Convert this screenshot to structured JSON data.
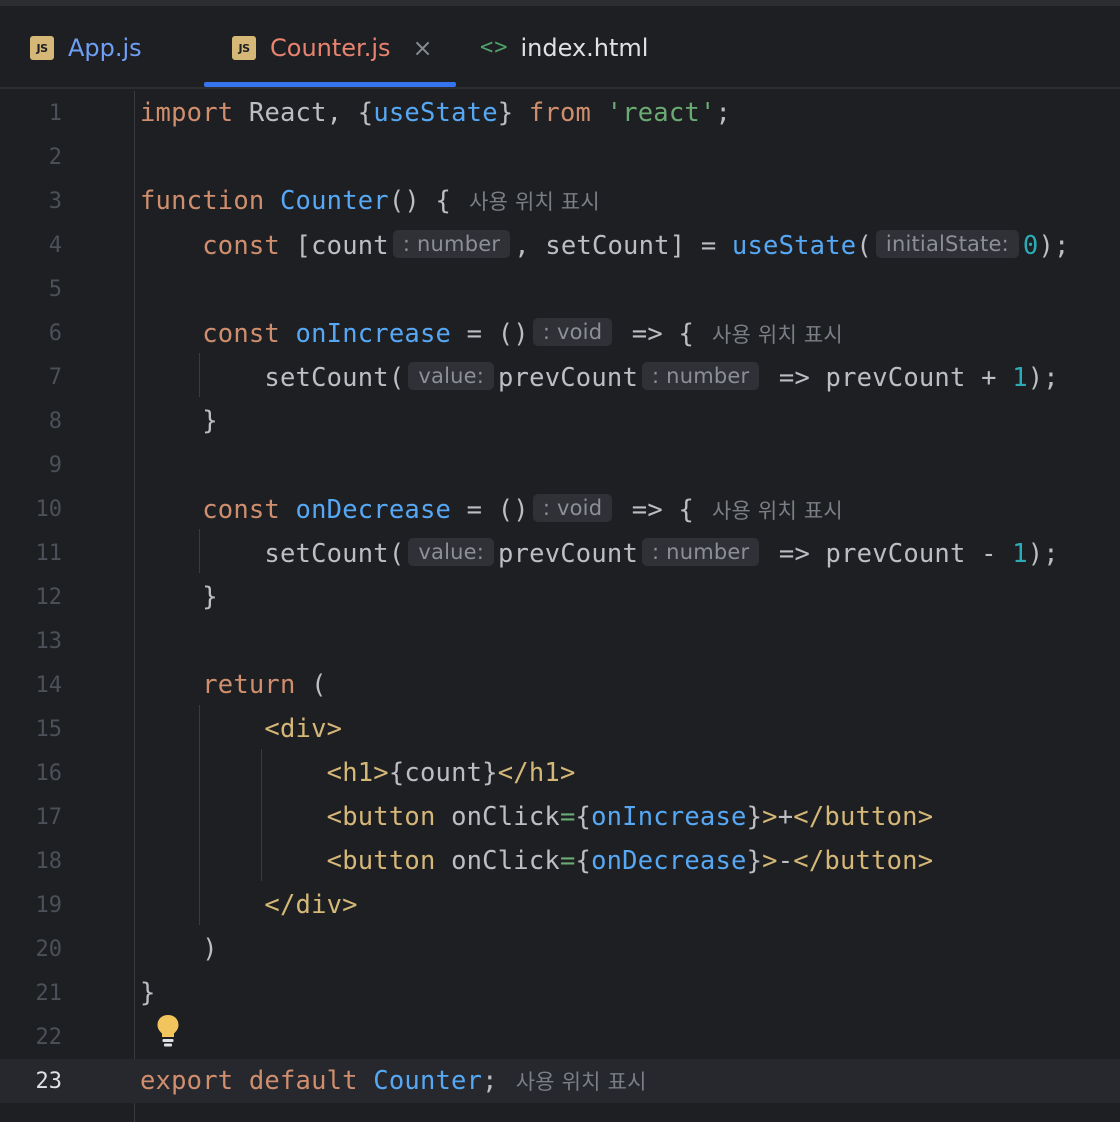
{
  "tabs": [
    {
      "label": "App.js",
      "icon": "js-file-icon"
    },
    {
      "label": "Counter.js",
      "icon": "js-file-icon",
      "active": true
    },
    {
      "label": "index.html",
      "icon": "html-file-icon"
    }
  ],
  "tab_icons": {
    "js": "JS",
    "html": "<>",
    "close": "×"
  },
  "usage_hint": "사용 위치 표시",
  "line_numbers": [
    "1",
    "2",
    "3",
    "4",
    "5",
    "6",
    "7",
    "8",
    "9",
    "10",
    "11",
    "12",
    "13",
    "14",
    "15",
    "16",
    "17",
    "18",
    "19",
    "20",
    "21",
    "22",
    "23"
  ],
  "current_line": "23",
  "code": {
    "l1": {
      "import": "import",
      "react": "React",
      "punc1": ", {",
      "useState": "useState",
      "punc2": "} ",
      "from": "from",
      "str": "'react'",
      "semi": ";"
    },
    "l3": {
      "function": "function",
      "name": "Counter",
      "rest": "() {"
    },
    "l4": {
      "const": "const",
      "open": "[count",
      "hint": ": number",
      "mid": ", setCount] = ",
      "useState": "useState",
      "paren": "(",
      "hint2": "initialState:",
      "zero": "0",
      "end": ");"
    },
    "l6": {
      "const": "const",
      "name": "onIncrease",
      "eq": " = ()",
      "hint": ": void",
      "arrow": " => {"
    },
    "l7": {
      "call": "setCount(",
      "hint": "value:",
      "arg": "prevCount",
      "hint2": ": number",
      "rest": " => prevCount + ",
      "one": "1",
      "end": ");"
    },
    "l8": {
      "text": "}"
    },
    "l10": {
      "const": "const",
      "name": "onDecrease",
      "eq": " = ()",
      "hint": ": void",
      "arrow": " => {"
    },
    "l11": {
      "call": "setCount(",
      "hint": "value:",
      "arg": "prevCount",
      "hint2": ": number",
      "rest": " => prevCount - ",
      "one": "1",
      "end": ");"
    },
    "l12": {
      "text": "}"
    },
    "l14": {
      "return": "return",
      "paren": " ("
    },
    "l15": {
      "tag": "<div>"
    },
    "l16": {
      "open": "<h1>",
      "expr": "{count}",
      "close": "</h1>"
    },
    "l17": {
      "open": "<button",
      "attr": " onClick",
      "eq": "=",
      "lb": "{",
      "ref": "onIncrease",
      "rb": "}",
      "gt": ">",
      "text": "+",
      "close": "</button>"
    },
    "l18": {
      "open": "<button",
      "attr": " onClick",
      "eq": "=",
      "lb": "{",
      "ref": "onDecrease",
      "rb": "}",
      "gt": ">",
      "text": "-",
      "close": "</button>"
    },
    "l19": {
      "tag": "</div>"
    },
    "l20": {
      "text": ")"
    },
    "l21": {
      "text": "}"
    },
    "l23": {
      "export": "export default",
      "name": "Counter",
      "semi": ";"
    }
  },
  "colors": {
    "background": "#1e1f22",
    "keyword": "#cf8e6d",
    "function": "#56a8f5",
    "string": "#6aab73",
    "number": "#2aacb8",
    "tag": "#d5b778",
    "tab_accent": "#3574f0"
  }
}
